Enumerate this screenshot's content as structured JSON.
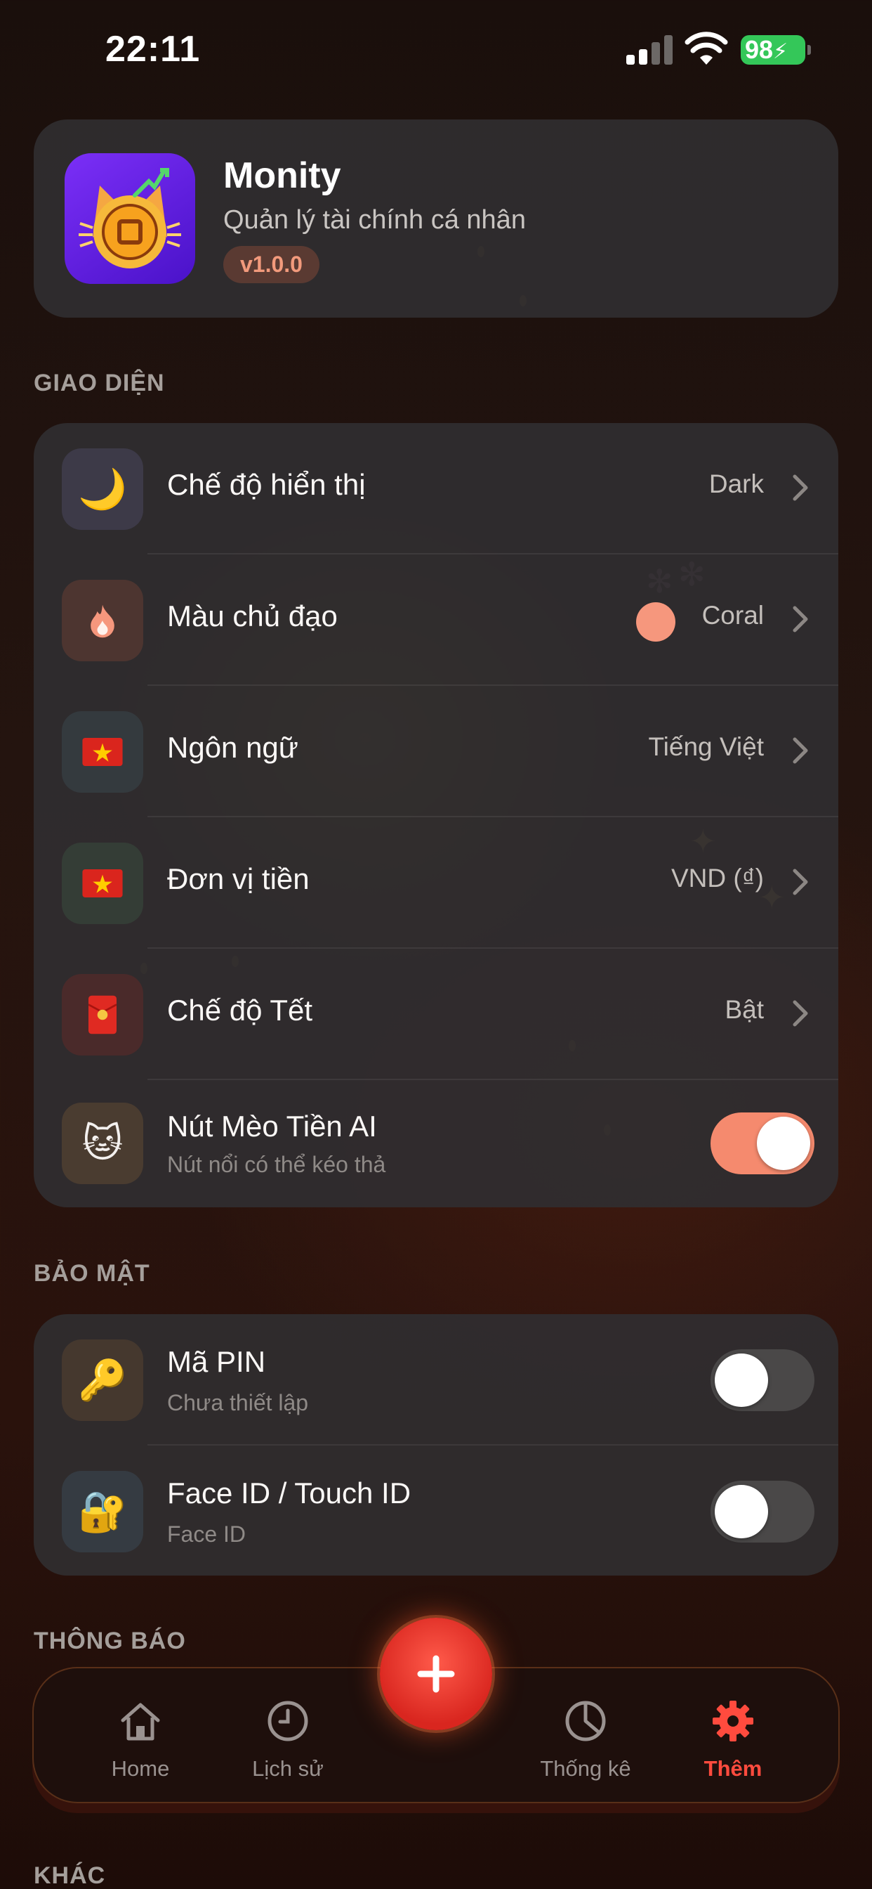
{
  "status_bar": {
    "time": "22:11",
    "battery": "98"
  },
  "app_info": {
    "name": "Monity",
    "subtitle": "Quản lý tài chính cá nhân",
    "version": "v1.0.0"
  },
  "sections": {
    "appearance": {
      "title": "GIAO DIỆN",
      "rows": [
        {
          "label": "Chế độ hiển thị",
          "value": "Dark",
          "icon": "moon-icon"
        },
        {
          "label": "Màu chủ đạo",
          "value": "Coral",
          "icon": "flame-icon",
          "color": "#f6977d"
        },
        {
          "label": "Ngôn ngữ",
          "value": "Tiếng Việt",
          "icon": "vietnam-flag-icon"
        },
        {
          "label": "Đơn vị tiền",
          "value": "VND (₫)",
          "icon": "vietnam-flag-icon"
        },
        {
          "label": "Chế độ Tết",
          "value": "Bật",
          "icon": "red-envelope-icon"
        },
        {
          "label": "Nút Mèo Tiền AI",
          "subtitle": "Nút nổi có thể kéo thả",
          "icon": "cat-icon",
          "toggle_on": true
        }
      ]
    },
    "security": {
      "title": "BẢO MẬT",
      "rows": [
        {
          "label": "Mã PIN",
          "subtitle": "Chưa thiết lập",
          "icon": "key-icon",
          "toggle_on": false
        },
        {
          "label": "Face ID / Touch ID",
          "subtitle": "Face ID",
          "icon": "lock-key-icon",
          "toggle_on": false
        }
      ]
    },
    "notifications": {
      "title": "THÔNG BÁO"
    },
    "other": {
      "title": "KHÁC"
    }
  },
  "tabbar": {
    "tabs": [
      {
        "label": "Home",
        "icon": "home-icon"
      },
      {
        "label": "Lịch sử",
        "icon": "clock-icon"
      },
      {
        "label": "Thống kê",
        "icon": "pie-chart-icon"
      },
      {
        "label": "Thêm",
        "icon": "gear-icon",
        "active": true
      }
    ],
    "fab_icon": "plus-icon"
  },
  "colors": {
    "accent": "#f58a6e",
    "active_tab": "#ff4b3e",
    "fab": "#e0302a"
  }
}
